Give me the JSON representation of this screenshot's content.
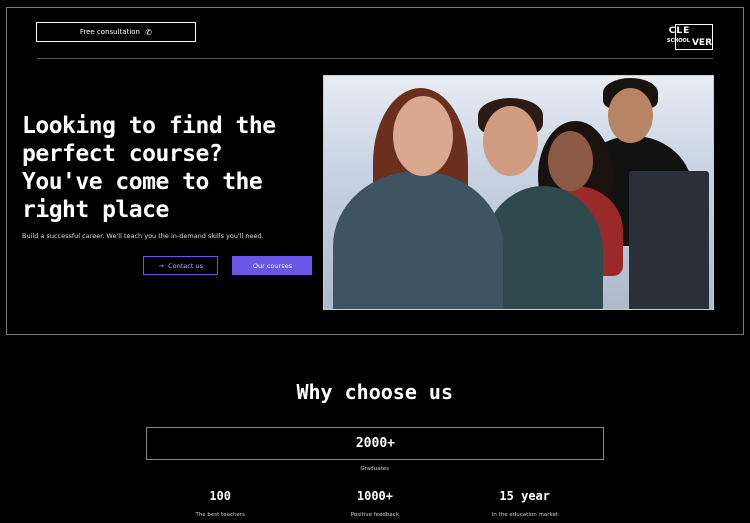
{
  "header": {
    "logo": {
      "line1": "CLE",
      "line2": "VER",
      "line3": "SCHOOL"
    },
    "consult_icon": "phone-icon",
    "consult_label": "Free consultation"
  },
  "hero": {
    "title": "Looking to find the perfect course? You've come to the right place",
    "subtitle": "Build a successful career. We'll teach you the in-demand skills you'll need.",
    "primary_button": "Our courses",
    "secondary_button": "Contact us",
    "secondary_icon": "arrow-right-icon",
    "accent": "#6b55e8"
  },
  "why": {
    "title": "Why choose us",
    "graduates": {
      "value": "2000+",
      "label": "Graduates"
    },
    "stats": [
      {
        "value": "15 year",
        "label": "In the education market"
      },
      {
        "value": "1000+",
        "label": "Positive feedback"
      },
      {
        "value": "100",
        "label": "The best teachers"
      }
    ]
  }
}
